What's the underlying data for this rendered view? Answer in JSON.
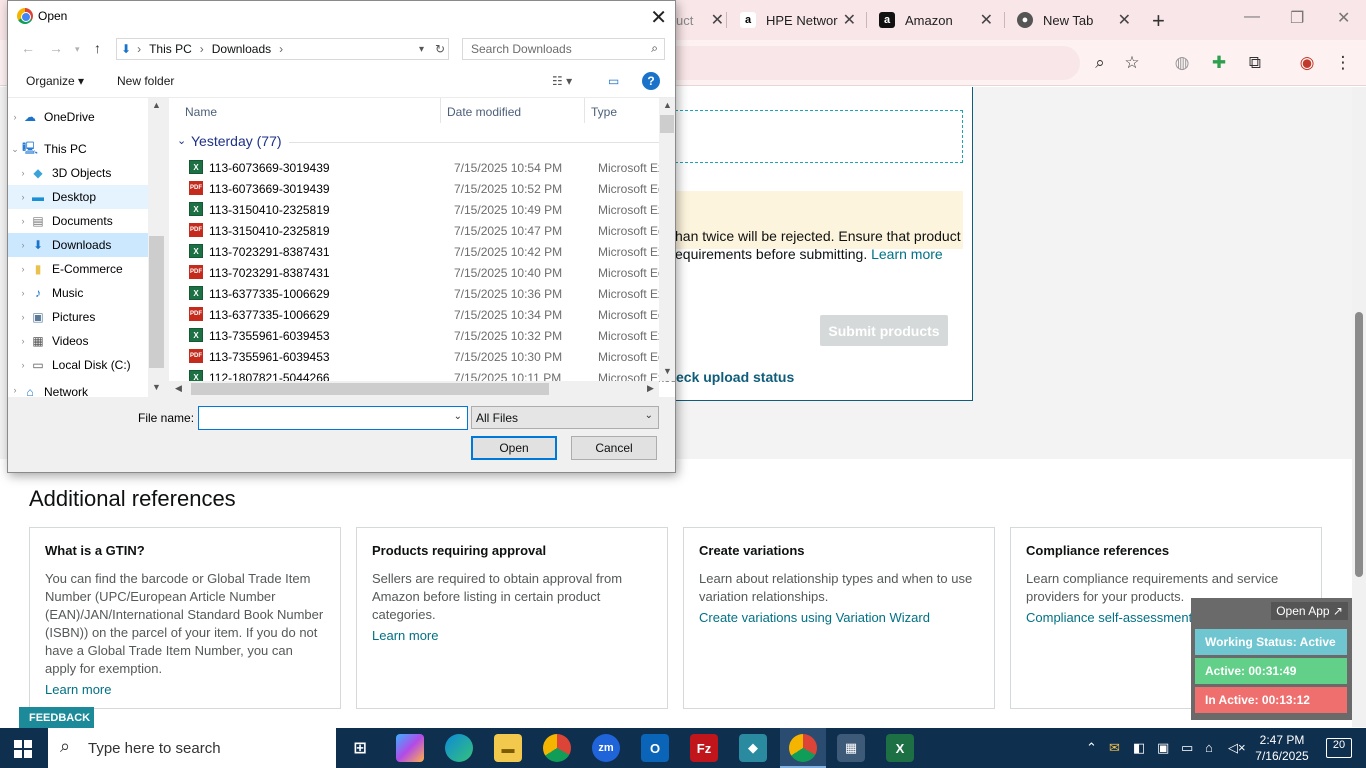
{
  "browser": {
    "tabs": [
      {
        "label": "uct",
        "favicon": "tab-icon"
      },
      {
        "label": "HPE Networ",
        "favicon": "amazon-icon"
      },
      {
        "label": "Amazon",
        "favicon": "amazon-icon"
      },
      {
        "label": "New Tab",
        "favicon": "chrome-icon"
      }
    ]
  },
  "page": {
    "warning_line1": "han twice will be rejected. Ensure that product",
    "warning_line2": "equirements before submitting.",
    "learn_more": "Learn more",
    "submit_label": "Submit products",
    "check_status": "eck upload status",
    "refs_title": "Additional references",
    "cards": [
      {
        "title": "What is a GTIN?",
        "body": "You can find the barcode or Global Trade Item Number (UPC/European Article Number (EAN)/JAN/International Standard Book Number (ISBN)) on the parcel of your item. If you do not have a Global Trade Item Number, you can apply for exemption.",
        "link": "Learn more"
      },
      {
        "title": "Products requiring approval",
        "body": "Sellers are required to obtain approval from Amazon before listing in certain product categories.",
        "link": "Learn more"
      },
      {
        "title": "Create variations",
        "body": "Learn about relationship types and when to use variation relationships.",
        "link": "Create variations using Variation Wizard"
      },
      {
        "title": "Compliance references",
        "body": "Learn compliance requirements and service providers for your products.",
        "link": "Compliance self-assessment"
      }
    ],
    "feedback": "FEEDBACK"
  },
  "widget": {
    "open_app": "Open App ↗",
    "working_status": "Working Status: Active",
    "active": "Active: 00:31:49",
    "inactive": "In Active: 00:13:12",
    "colors": {
      "status": "#6fc6d0",
      "active": "#63d08a",
      "inactive": "#ef6f6f"
    }
  },
  "dialog": {
    "title": "Open",
    "breadcrumb": [
      "This PC",
      "Downloads"
    ],
    "search_placeholder": "Search Downloads",
    "organize": "Organize ▾",
    "new_folder": "New folder",
    "nav": [
      {
        "label": "OneDrive",
        "icon": "cloud-icon",
        "state": ""
      },
      {
        "label": "This PC",
        "icon": "computer-icon",
        "state": ""
      },
      {
        "label": "3D Objects",
        "icon": "cube-icon",
        "state": ""
      },
      {
        "label": "Desktop",
        "icon": "desktop-icon",
        "state": "hl"
      },
      {
        "label": "Documents",
        "icon": "document-icon",
        "state": ""
      },
      {
        "label": "Downloads",
        "icon": "download-icon",
        "state": "sel"
      },
      {
        "label": "E-Commerce",
        "icon": "folder-icon",
        "state": ""
      },
      {
        "label": "Music",
        "icon": "music-icon",
        "state": ""
      },
      {
        "label": "Pictures",
        "icon": "picture-icon",
        "state": ""
      },
      {
        "label": "Videos",
        "icon": "video-icon",
        "state": ""
      },
      {
        "label": "Local Disk (C:)",
        "icon": "disk-icon",
        "state": ""
      },
      {
        "label": "Network",
        "icon": "network-icon",
        "state": ""
      }
    ],
    "columns": {
      "name": "Name",
      "date": "Date modified",
      "type": "Type"
    },
    "group": "Yesterday (77)",
    "files": [
      {
        "name": "113-6073669-3019439",
        "date": "7/15/2025 10:54 PM",
        "type": "Microsoft Excel",
        "kind": "xls"
      },
      {
        "name": "113-6073669-3019439",
        "date": "7/15/2025 10:52 PM",
        "type": "Microsoft Edge",
        "kind": "pdf"
      },
      {
        "name": "113-3150410-2325819",
        "date": "7/15/2025 10:49 PM",
        "type": "Microsoft Excel",
        "kind": "xls"
      },
      {
        "name": "113-3150410-2325819",
        "date": "7/15/2025 10:47 PM",
        "type": "Microsoft Edge",
        "kind": "pdf"
      },
      {
        "name": "113-7023291-8387431",
        "date": "7/15/2025 10:42 PM",
        "type": "Microsoft Excel",
        "kind": "xls"
      },
      {
        "name": "113-7023291-8387431",
        "date": "7/15/2025 10:40 PM",
        "type": "Microsoft Edge",
        "kind": "pdf"
      },
      {
        "name": "113-6377335-1006629",
        "date": "7/15/2025 10:36 PM",
        "type": "Microsoft Excel",
        "kind": "xls"
      },
      {
        "name": "113-6377335-1006629",
        "date": "7/15/2025 10:34 PM",
        "type": "Microsoft Edge",
        "kind": "pdf"
      },
      {
        "name": "113-7355961-6039453",
        "date": "7/15/2025 10:32 PM",
        "type": "Microsoft Excel",
        "kind": "xls"
      },
      {
        "name": "113-7355961-6039453",
        "date": "7/15/2025 10:30 PM",
        "type": "Microsoft Edge",
        "kind": "pdf"
      },
      {
        "name": "112-1807821-5044266",
        "date": "7/15/2025 10:11 PM",
        "type": "Microsoft Excel",
        "kind": "xls"
      }
    ],
    "file_name_label": "File name:",
    "file_name_value": "",
    "filter": "All Files",
    "open": "Open",
    "cancel": "Cancel"
  },
  "taskbar": {
    "search_placeholder": "Type here to search",
    "time": "2:47 PM",
    "date": "7/16/2025",
    "notifications": "20"
  }
}
